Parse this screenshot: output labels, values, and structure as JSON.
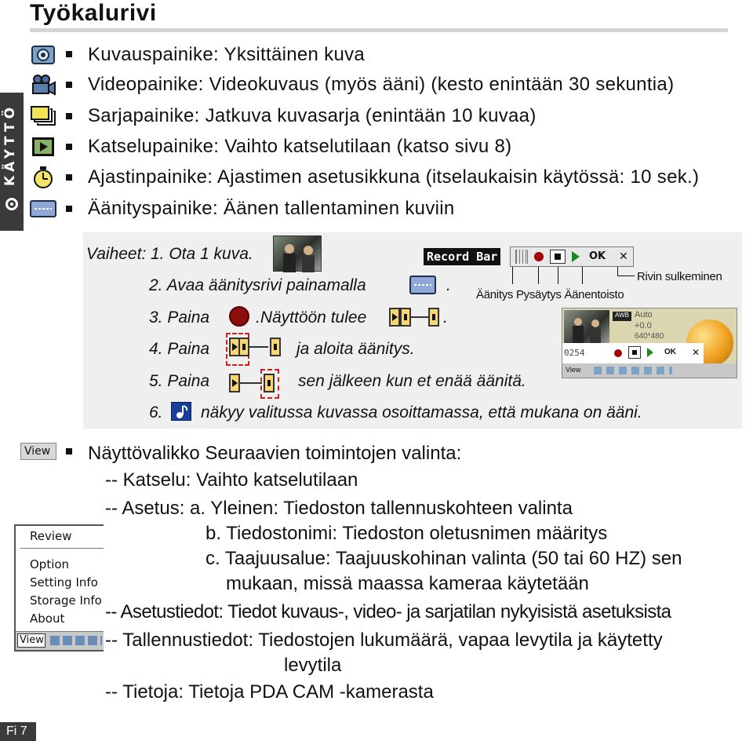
{
  "page": {
    "title": "Työkalurivi",
    "side_tab": "KÄYTTÖ",
    "page_number": "Fi 7"
  },
  "features": [
    {
      "icon": "camera-icon",
      "text": "Kuvauspainike: Yksittäinen kuva"
    },
    {
      "icon": "video-camera-icon",
      "text": "Videopainike: Videokuvaus (myös ääni) (kesto enintään 30 sekuntia)"
    },
    {
      "icon": "burst-icon",
      "text": "Sarjapainike: Jatkuva kuvasarja (enintään 10 kuvaa)"
    },
    {
      "icon": "playback-icon",
      "text": "Katselupainike: Vaihto katselutilaan (katso sivu 8)"
    },
    {
      "icon": "timer-icon",
      "text": "Ajastinpainike: Ajastimen asetusikkuna (itselaukaisin käytössä: 10 sek.)"
    },
    {
      "icon": "audio-record-icon",
      "text": "Äänityspainike: Äänen tallentaminen kuviin"
    }
  ],
  "steps": {
    "prefix": "Vaiheet:",
    "s1": "1. Ota 1 kuva.",
    "s2a": "2. Avaa äänitysrivi painamalla",
    "s2b": ".",
    "s3a": "3. Paina",
    "s3b": ".Näyttöön tulee",
    "s3c": ".",
    "s4a": "4. Paina",
    "s4b": "ja aloita äänitys.",
    "s5a": "5. Paina",
    "s5b": "sen jälkeen kun et enää äänitä.",
    "s6a": "6.",
    "s6b": "näkyy valitussa kuvassa osoittamassa, että mukana on ääni."
  },
  "record_bar": {
    "label": "Record Bar",
    "ok": "OK",
    "close": "✕",
    "callout_close": "Rivin sulkeminen",
    "callout_labels": "Äänitys Pysäytys Äänentoisto"
  },
  "screenshot": {
    "counter": "0254",
    "ok": "OK",
    "close": "✕",
    "awb": "AWB",
    "auto": "Auto",
    "ev": "+0.0",
    "res": "640*480",
    "view": "View"
  },
  "view_section": {
    "view_button": "View",
    "title": "Näyttövalikko Seuraavien toimintojen valinta:",
    "l1": "-- Katselu: Vaihto katselutilaan",
    "l2": "-- Asetus: a. Yleinen: Tiedoston tallennuskohteen valinta",
    "l3": "b. Tiedostonimi: Tiedoston oletusnimen määritys",
    "l4": "c. Taajuusalue: Taajuuskohinan valinta (50 tai 60 HZ) sen",
    "l5": "mukaan, missä maassa kameraa käytetään",
    "l6": "-- Asetustiedot: Tiedot kuvaus-, video- ja sarjatilan nykyisistä asetuksista",
    "l7": "-- Tallennustiedot: Tiedostojen lukumäärä, vapaa levytila ja käytetty",
    "l8": "levytila",
    "l9": "-- Tietoja: Tietoja PDA CAM -kamerasta"
  },
  "view_menu": {
    "items": [
      "Review",
      "Option",
      "Setting Info",
      "Storage Info",
      "About"
    ],
    "footer": "View"
  }
}
